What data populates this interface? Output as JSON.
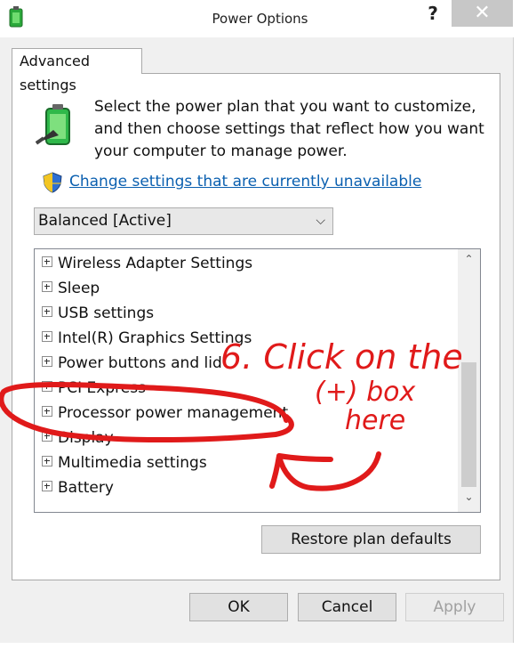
{
  "window": {
    "title": "Power Options",
    "help_label": "?",
    "close_label": "✕"
  },
  "tab": {
    "label": "Advanced settings"
  },
  "intro_text": "Select the power plan that you want to customize, and then choose settings that reflect how you want your computer to manage power.",
  "change_link": "Change settings that are currently unavailable",
  "plan_select": {
    "value": "Balanced [Active]"
  },
  "tree_items": [
    "Wireless Adapter Settings",
    "Sleep",
    "USB settings",
    "Intel(R) Graphics Settings",
    "Power buttons and lid",
    "PCI Express",
    "Processor power management",
    "Display",
    "Multimedia settings",
    "Battery"
  ],
  "buttons": {
    "restore": "Restore plan defaults",
    "ok": "OK",
    "cancel": "Cancel",
    "apply": "Apply"
  },
  "annotation": {
    "line1": "6. Click on the",
    "line2": "(+) box",
    "line3": "here",
    "color": "#e01a1a"
  }
}
